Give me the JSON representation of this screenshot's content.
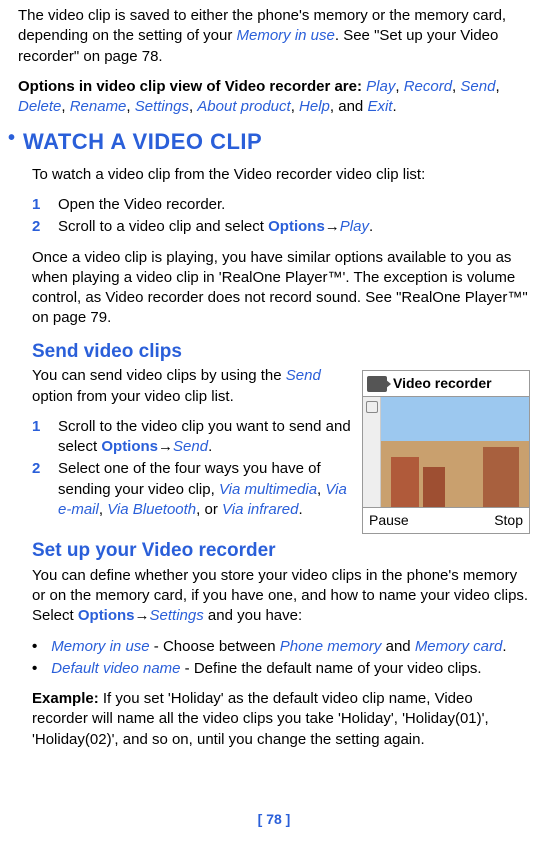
{
  "intro": {
    "p1_a": "The video clip is saved to either the phone's memory or the memory card, depending on the setting of your ",
    "memory_in_use": "Memory in use",
    "p1_b": ". See \"Set up your Video recorder\" on page 78.",
    "p2_a": "Options in video clip view of Video recorder are:",
    "opt_play": "Play",
    "opt_record": "Record",
    "opt_send": "Send",
    "opt_delete": "Delete",
    "opt_rename": "Rename",
    "opt_settings": "Settings",
    "opt_about": "About product",
    "opt_help": "Help",
    "opt_exit": "Exit",
    "and": ", and "
  },
  "watch": {
    "heading": "WATCH A VIDEO CLIP",
    "p1": "To watch a video clip from the Video recorder video clip list:",
    "s1n": "1",
    "s1": "Open the Video recorder.",
    "s2n": "2",
    "s2a": "Scroll to a video clip and select ",
    "s2_options": "Options",
    "s2_arrow": "→",
    "s2_play": "Play",
    "p2": "Once a video clip is playing, you have similar options available to you as when playing a video clip in 'RealOne Player™'. The exception is volume control, as Video recorder does not record sound. See  \"RealOne Player™\" on page 79."
  },
  "send": {
    "heading": "Send video clips",
    "p1a": "You can send video clips by using the ",
    "p1_send": "Send",
    "p1b": " option from your video clip list.",
    "s1n": "1",
    "s1a": "Scroll to the video clip you want to send and select ",
    "s1_options": "Options",
    "s1_arrow": "→",
    "s1_send": "Send",
    "s2n": "2",
    "s2a": "Select one of the four ways you have of sending your video clip, ",
    "via_mm": "Via multimedia",
    "via_em": "Via e-mail",
    "via_bt": "Via Bluetooth",
    "via_ir": "Via infrared",
    "or": ", or "
  },
  "figure": {
    "title": "Video recorder",
    "left": "Pause",
    "right": "Stop"
  },
  "setup": {
    "heading": "Set up your Video recorder",
    "p1a": "You can define whether you store your video clips in the phone's memory or on the memory card, if you have one, and how to name your video clips. Select ",
    "p1_options": "Options",
    "p1_arrow": "→",
    "p1_settings": "Settings",
    "p1b": " and you have:",
    "b1_label": "Memory in use",
    "b1_mid": " - Choose between ",
    "b1_pm": "Phone memory",
    "b1_and": " and ",
    "b1_mc": "Memory card",
    "b2_label": "Default video name",
    "b2_txt": " - Define the default name of your video clips.",
    "ex_label": "Example:",
    "ex_txt": " If you set 'Holiday' as the default video clip name, Video recorder will name all the video clips you take 'Holiday', 'Holiday(01)', 'Holiday(02)', and so on, until you change the setting again."
  },
  "page": "[ 78 ]"
}
